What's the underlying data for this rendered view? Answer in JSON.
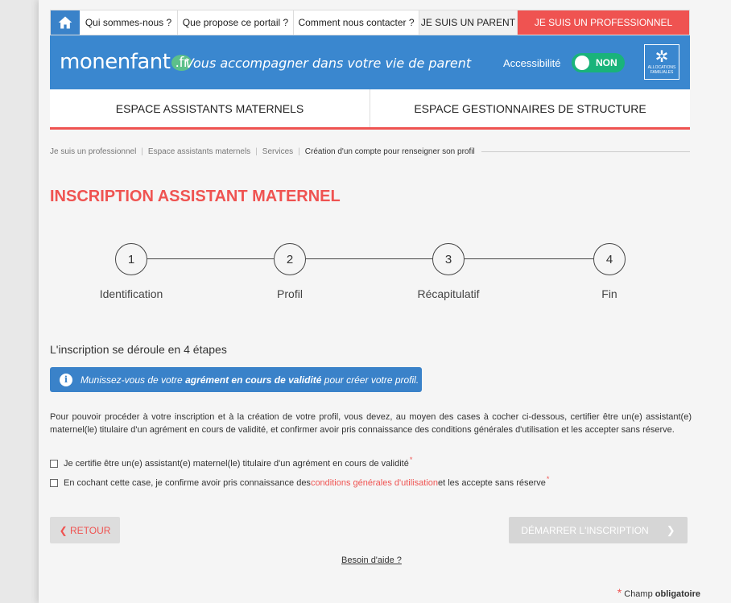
{
  "topnav": {
    "items": [
      "Qui sommes-nous ?",
      "Que propose ce portail ?",
      "Comment nous contacter ?"
    ],
    "parent": "JE SUIS UN PARENT",
    "professional": "JE SUIS UN PROFESSIONNEL"
  },
  "banner": {
    "logo_main": "monenfant",
    "logo_suffix": ".fr",
    "tagline": "Vous accompagner dans votre vie de parent",
    "accessibility_label": "Accessibilité",
    "toggle_value": "NON",
    "caf_caption": "ALLOCATIONS FAMILIALES"
  },
  "spaces": [
    "ESPACE ASSISTANTS MATERNELS",
    "ESPACE GESTIONNAIRES DE STRUCTURE"
  ],
  "breadcrumb": [
    "Je suis un professionnel",
    "Espace assistants maternels",
    "Services",
    "Création d'un compte pour renseigner son profil"
  ],
  "title": "INSCRIPTION ASSISTANT MATERNEL",
  "steps": [
    {
      "num": "1",
      "label": "Identification"
    },
    {
      "num": "2",
      "label": "Profil"
    },
    {
      "num": "3",
      "label": "Récapitulatif"
    },
    {
      "num": "4",
      "label": "Fin"
    }
  ],
  "subtitle": "L'inscription se déroule en 4 étapes",
  "info": {
    "before": "Munissez-vous de votre ",
    "bold": "agrément en cours de validité",
    "after": " pour créer votre profil."
  },
  "paragraph": "Pour pouvoir procéder à votre inscription et à la création de votre profil, vous devez, au moyen des cases à cocher ci-dessous, certifier être un(e) assistant(e) maternel(le) titulaire d'un agrément en cours de validité, et confirmer avoir pris connaissance des conditions générales d'utilisation et les accepter sans réserve.",
  "checkboxes": {
    "certify": "Je certifie être un(e) assistant(e) maternel(le) titulaire d'un agrément en cours de validité",
    "cgu_before": "En cochant cette case, je confirme avoir pris connaissance des ",
    "cgu_link": "conditions générales d'utilisation",
    "cgu_after": " et les accepte sans réserve",
    "required_mark": "*"
  },
  "buttons": {
    "back": "RETOUR",
    "start": "DÉMARRER L'INSCRIPTION"
  },
  "help": "Besoin d'aide ?",
  "required_note": {
    "star": "*",
    "text": " Champ ",
    "bold": "obligatoire"
  },
  "colors": {
    "brand_blue": "#3a87cf",
    "accent_red": "#ef5351",
    "toggle_green": "#19b37a"
  },
  "icons": [
    "home-icon",
    "info-icon",
    "chevron-left-icon",
    "chevron-right-icon"
  ]
}
